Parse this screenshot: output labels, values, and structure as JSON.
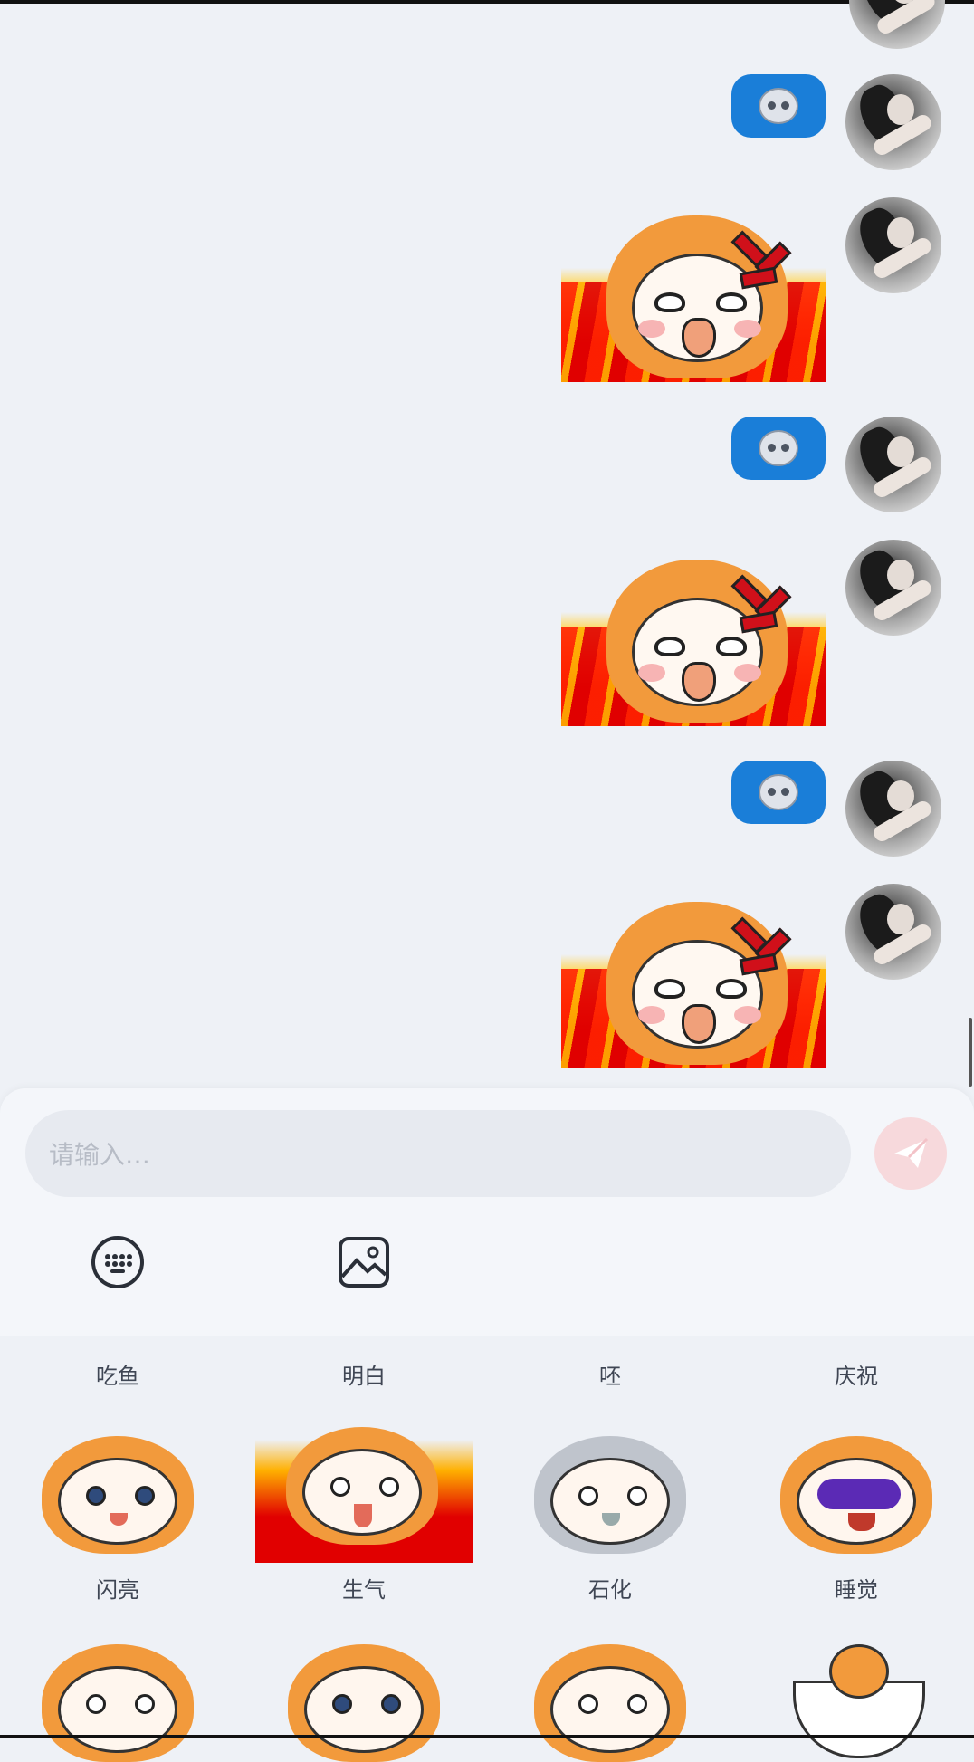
{
  "chat": {
    "messages": [
      {
        "type": "emoji",
        "icon": "skull-face-emoji"
      },
      {
        "type": "sticker",
        "icon": "angry-girl-fire-sticker"
      },
      {
        "type": "emoji",
        "icon": "skull-face-emoji"
      },
      {
        "type": "sticker",
        "icon": "angry-girl-fire-sticker"
      },
      {
        "type": "emoji",
        "icon": "skull-face-emoji"
      },
      {
        "type": "sticker",
        "icon": "angry-girl-fire-sticker"
      }
    ]
  },
  "composer": {
    "placeholder": "请输入…",
    "send_icon": "paper-plane-icon",
    "tools": [
      {
        "icon": "keyboard-icon"
      },
      {
        "icon": "image-icon"
      }
    ]
  },
  "stickers": {
    "row1_labels": [
      "吃鱼",
      "明白",
      "呸",
      "庆祝"
    ],
    "row2_labels": [
      "闪亮",
      "生气",
      "石化",
      "睡觉"
    ]
  },
  "colors": {
    "bubble_blue": "#1a7ed8",
    "send_pink": "#f7d9dc",
    "background": "#eef1f6"
  }
}
